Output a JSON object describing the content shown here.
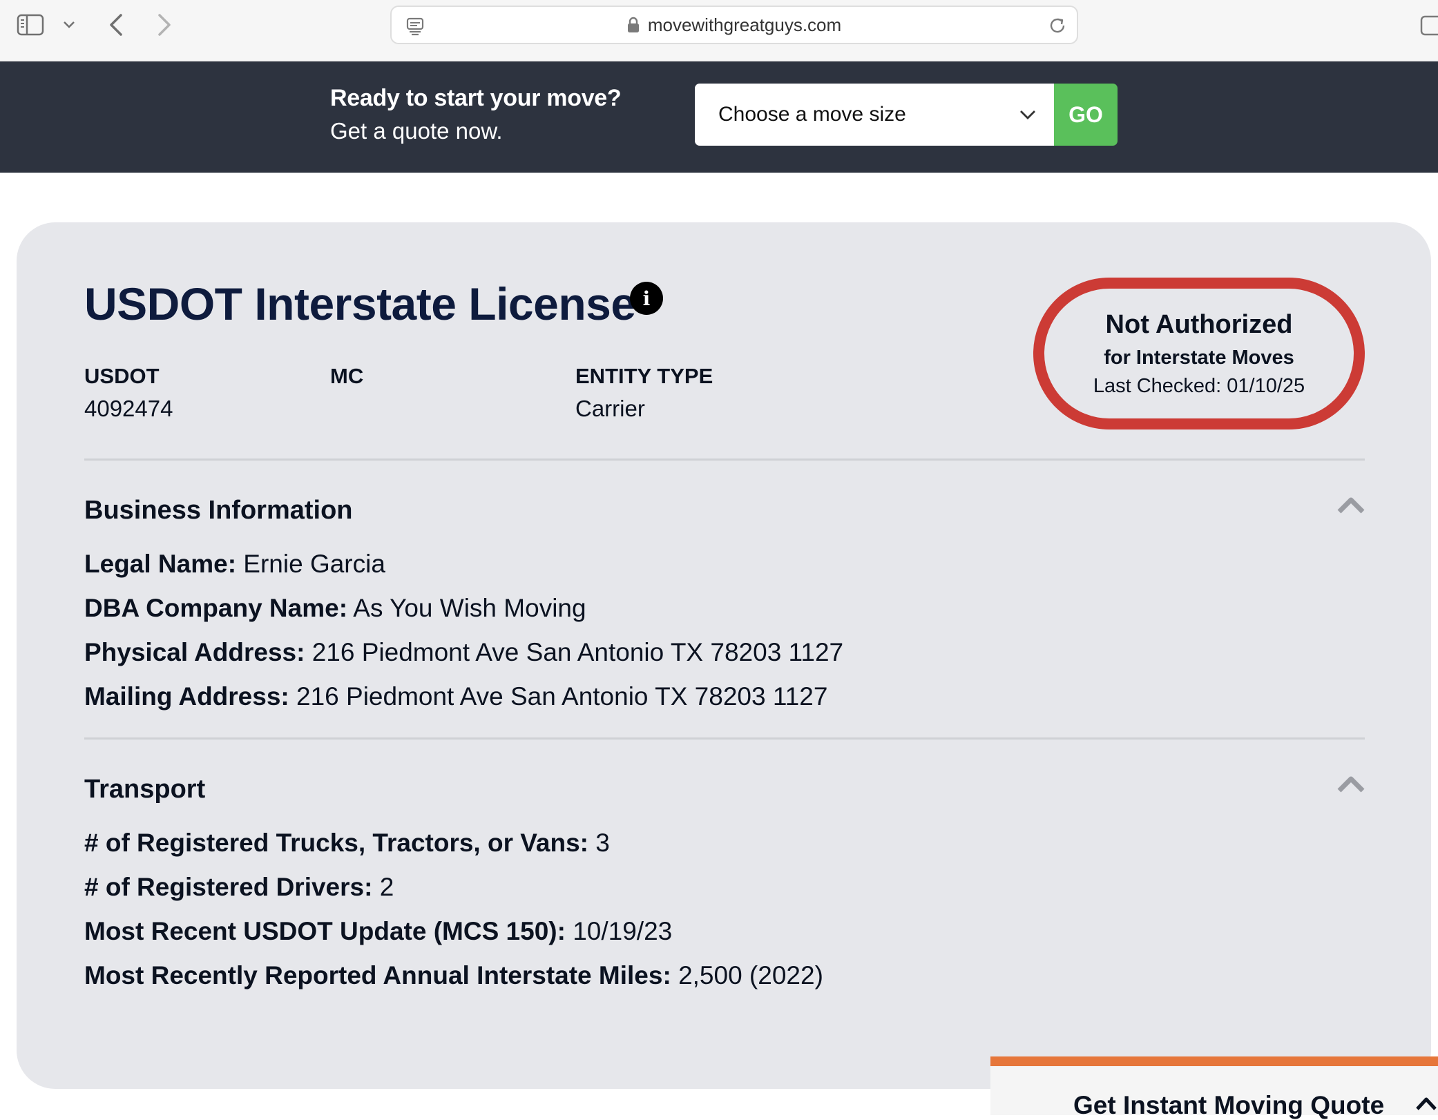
{
  "browser": {
    "url": "movewithgreatguys.com"
  },
  "banner": {
    "headline": "Ready to start your move?",
    "subline": "Get a quote now.",
    "select_value": "Choose a move size",
    "go_label": "GO"
  },
  "license": {
    "title": "USDOT Interstate License",
    "usdot_label": "USDOT",
    "usdot_value": "4092474",
    "mc_label": "MC",
    "entity_label": "ENTITY TYPE",
    "entity_value": "Carrier",
    "status": {
      "main": "Not Authorized",
      "sub": "for Interstate Moves",
      "checked": "Last Checked: 01/10/25",
      "color": "#cc3b35"
    }
  },
  "business": {
    "title": "Business Information",
    "rows": [
      {
        "label": "Legal Name:",
        "value": "Ernie Garcia"
      },
      {
        "label": "DBA Company Name:",
        "value": "As You Wish Moving"
      },
      {
        "label": "Physical Address:",
        "value": "216 Piedmont Ave San Antonio TX 78203 1127"
      },
      {
        "label": "Mailing Address:",
        "value": "216 Piedmont Ave San Antonio TX 78203 1127"
      }
    ]
  },
  "transport": {
    "title": "Transport",
    "rows": [
      {
        "label": "# of Registered Trucks, Tractors, or Vans:",
        "value": "3"
      },
      {
        "label": "# of Registered Drivers:",
        "value": "2"
      },
      {
        "label": "Most Recent USDOT Update (MCS 150):",
        "value": "10/19/23"
      },
      {
        "label": "Most Recently Reported Annual Interstate Miles:",
        "value": "2,500 (2022)"
      }
    ]
  },
  "widget": {
    "label": "Get Instant Moving Quote",
    "accent": "#e6763a"
  },
  "colors": {
    "banner_bg": "#2d333f",
    "go_green": "#5ac05b",
    "card_bg": "#e6e7eb",
    "title_navy": "#0e1b3d"
  }
}
